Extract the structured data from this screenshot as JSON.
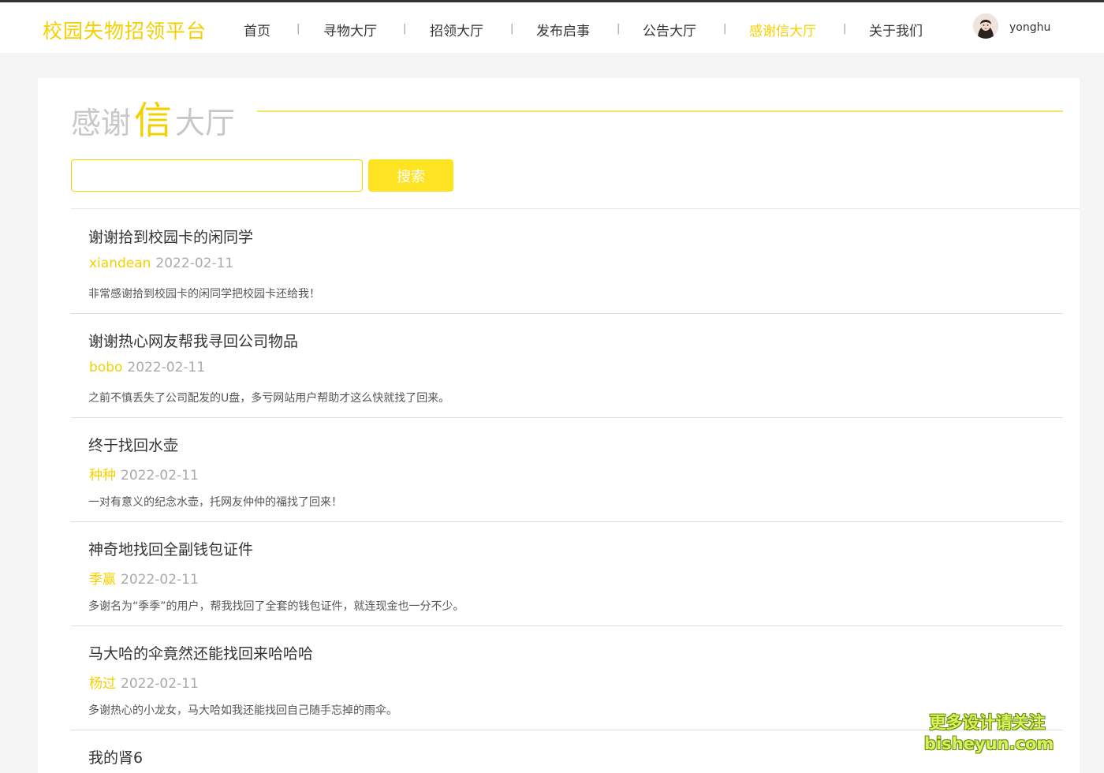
{
  "app": {
    "logo": "校园失物招领平台"
  },
  "nav": {
    "items": [
      "首页",
      "寻物大厅",
      "招领大厅",
      "发布启事",
      "公告大厅",
      "感谢信大厅",
      "关于我们"
    ],
    "separator": "|",
    "active_index": 5
  },
  "user": {
    "name": "yonghu"
  },
  "page": {
    "heading_a": "感谢",
    "heading_b": "信",
    "heading_c": "大厅"
  },
  "search": {
    "value": "",
    "button_label": "搜索"
  },
  "posts": [
    {
      "title": "谢谢拾到校园卡的闲同学",
      "author": "xiandean",
      "date": "2022-02-11",
      "body": "非常感谢拾到校园卡的闲同学把校园卡还给我！"
    },
    {
      "title": "谢谢热心网友帮我寻回公司物品",
      "author": "bobo",
      "date": "2022-02-11",
      "body": "之前不慎丢失了公司配发的U盘，多亏网站用户帮助才这么快就找了回来。"
    },
    {
      "title": "终于找回水壶",
      "author": "种种",
      "date": "2022-02-11",
      "body": "一对有意义的纪念水壶，托网友仲仲的福找了回来！"
    },
    {
      "title": "神奇地找回全副钱包证件",
      "author": "季赢",
      "date": "2022-02-11",
      "body": "多谢名为“季季”的用户，帮我找回了全套的钱包证件，就连现金也一分不少。"
    },
    {
      "title": "马大哈的伞竟然还能找回来哈哈哈",
      "author": "杨过",
      "date": "2022-02-11",
      "body": "多谢热心的小龙女，马大哈如我还能找回自己随手忘掉的雨伞。"
    },
    {
      "title": "我的肾6",
      "author": "",
      "date": "",
      "body": ""
    }
  ],
  "watermark": {
    "line1": "更多设计请关注",
    "line2": "bisheyun.com"
  },
  "colors": {
    "accent": "#f5d000",
    "button": "#fde322"
  }
}
